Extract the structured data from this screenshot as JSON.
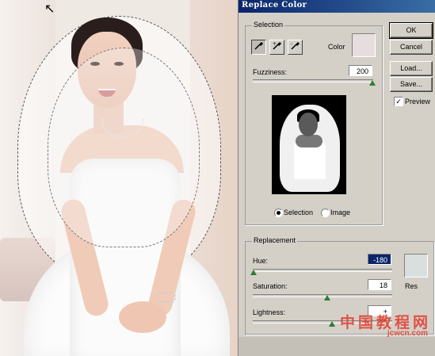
{
  "dialog": {
    "title": "Replace Color",
    "buttons": {
      "ok": "OK",
      "cancel": "Cancel",
      "load": "Load...",
      "save": "Save..."
    },
    "preview_checkbox": {
      "label": "Preview",
      "checked": true
    },
    "selection": {
      "group_label": "Selection",
      "tools": [
        "eyedropper-icon",
        "eyedropper-plus-icon",
        "eyedropper-minus-icon"
      ],
      "color_label": "Color",
      "color_swatch": "#e6dede",
      "fuzziness_label": "Fuzziness:",
      "fuzziness_value": "200",
      "fuzziness_max": 200,
      "view_options": [
        {
          "label": "Selection",
          "selected": true
        },
        {
          "label": "Image",
          "selected": false
        }
      ]
    },
    "replacement": {
      "group_label": "Replacement",
      "hue_label": "Hue:",
      "hue_value": "-180",
      "saturation_label": "Saturation:",
      "saturation_value": "18",
      "lightness_label": "Lightness:",
      "lightness_value": "+",
      "result_label": "Res",
      "result_swatch": "#d9dedf"
    }
  },
  "watermark": {
    "main": "中国教程网",
    "url": "jcwcn.com"
  },
  "colors": {
    "titlebar": "#0a246a",
    "dialog_bg": "#d4d0c8"
  }
}
